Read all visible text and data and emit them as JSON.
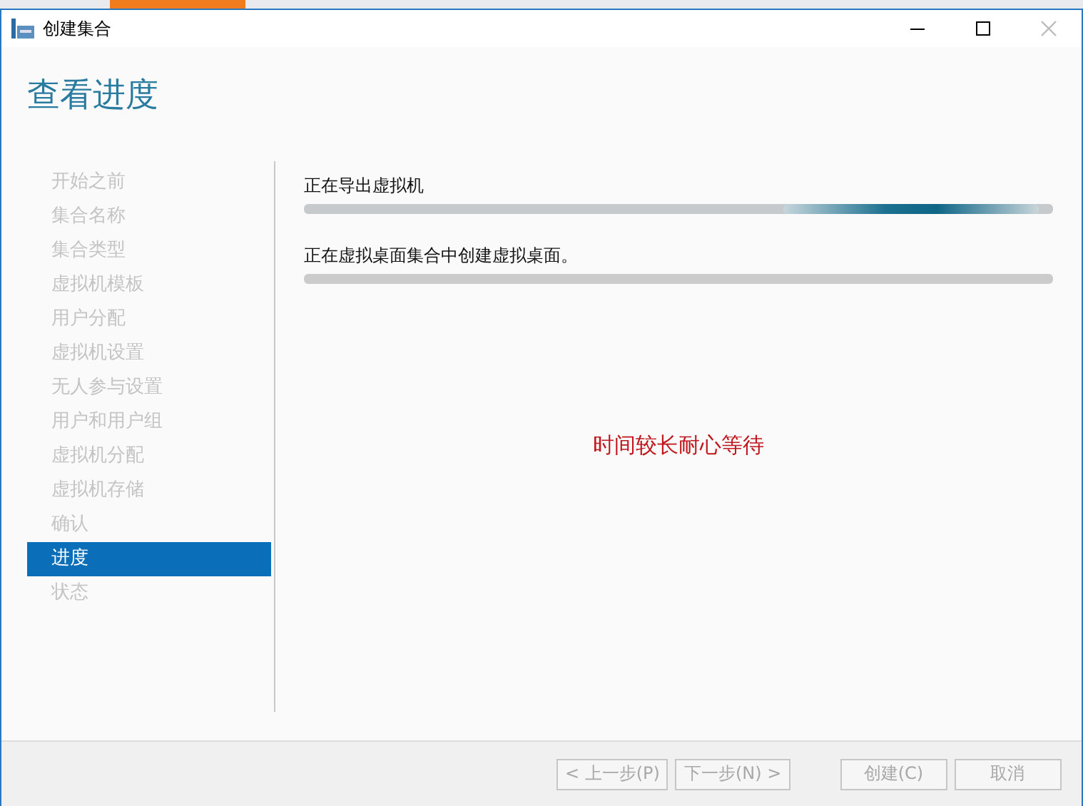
{
  "window": {
    "title": "创建集合"
  },
  "heading": "查看进度",
  "steps": [
    {
      "label": "开始之前",
      "selected": false
    },
    {
      "label": "集合名称",
      "selected": false
    },
    {
      "label": "集合类型",
      "selected": false
    },
    {
      "label": "虚拟机模板",
      "selected": false
    },
    {
      "label": "用户分配",
      "selected": false
    },
    {
      "label": "虚拟机设置",
      "selected": false
    },
    {
      "label": "无人参与设置",
      "selected": false
    },
    {
      "label": "用户和用户组",
      "selected": false
    },
    {
      "label": "虚拟机分配",
      "selected": false
    },
    {
      "label": "虚拟机存储",
      "selected": false
    },
    {
      "label": "确认",
      "selected": false
    },
    {
      "label": "进度",
      "selected": true
    },
    {
      "label": "状态",
      "selected": false
    }
  ],
  "tasks": [
    {
      "label": "正在导出虚拟机",
      "active": true
    },
    {
      "label": "正在虚拟桌面集合中创建虚拟桌面。",
      "active": false
    }
  ],
  "note": "时间较长耐心等待",
  "buttons": [
    {
      "label": "< 上一步(P)",
      "disabled": true
    },
    {
      "label": "下一步(N) >",
      "disabled": true
    },
    {
      "label": "创建(C)",
      "disabled": true
    },
    {
      "label": "取消",
      "disabled": true
    }
  ]
}
